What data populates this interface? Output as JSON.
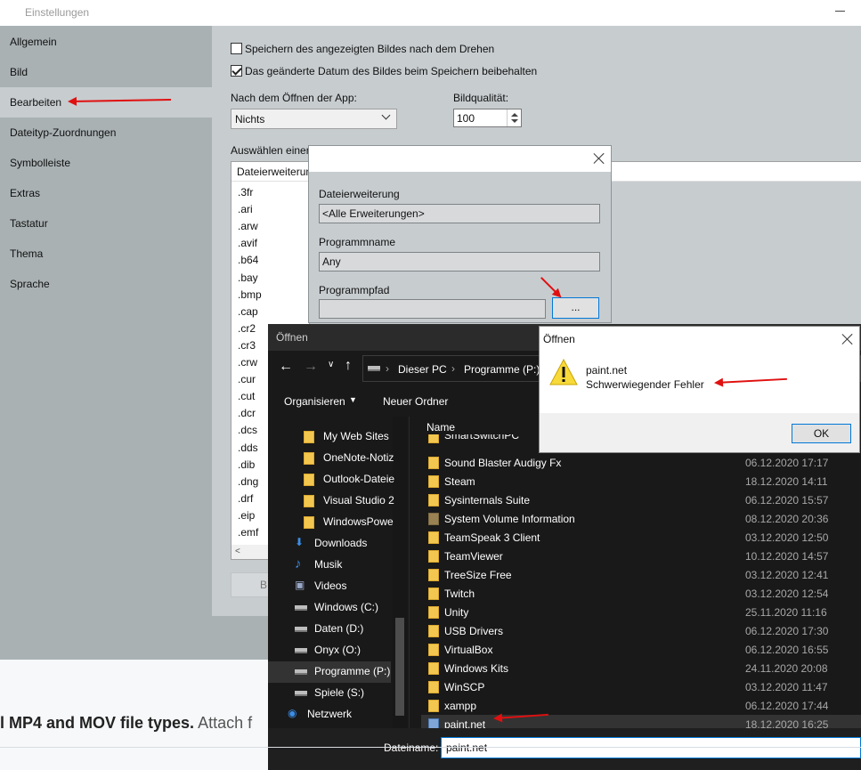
{
  "settings": {
    "title": "Einstellungen",
    "sidebar": [
      {
        "label": "Allgemein"
      },
      {
        "label": "Bild"
      },
      {
        "label": "Bearbeiten",
        "active": true
      },
      {
        "label": "Dateityp-Zuordnungen"
      },
      {
        "label": "Symbolleiste"
      },
      {
        "label": "Extras"
      },
      {
        "label": "Tastatur"
      },
      {
        "label": "Thema"
      },
      {
        "label": "Sprache"
      }
    ],
    "save_rotated_label": "Speichern des angezeigten Bildes nach dem Drehen",
    "save_rotated_checked": false,
    "keep_date_label": "Das geänderte Datum des Bildes beim Speichern beibehalten",
    "keep_date_checked": true,
    "after_open_label": "Nach dem Öffnen der App:",
    "after_open_value": "Nichts",
    "quality_label": "Bildqualität:",
    "quality_value": "100",
    "select_label": "Auswählen einer",
    "ext_header": "Dateierweiterung",
    "extensions": [
      ".3fr",
      ".ari",
      ".arw",
      ".avif",
      ".b64",
      ".bay",
      ".bmp",
      ".cap",
      ".cr2",
      ".cr3",
      ".crw",
      ".cur",
      ".cut",
      ".dcr",
      ".dcs",
      ".dds",
      ".dib",
      ".dng",
      ".drf",
      ".eip",
      ".emf"
    ],
    "ghost_button_label": "B"
  },
  "edit_dialog": {
    "ext_label": "Dateierweiterung",
    "ext_value": "<Alle Erweiterungen>",
    "prog_label": "Programmname",
    "prog_value": "Any",
    "path_label": "Programmpfad",
    "path_value": "",
    "browse_label": "..."
  },
  "open_dialog": {
    "title": "Öffnen",
    "breadcrumb": [
      "Dieser PC",
      "Programme (P:)"
    ],
    "organize_label": "Organisieren",
    "new_folder_label": "Neuer Ordner",
    "nav_items": [
      {
        "label": "My Web Sites",
        "icon": "folder-icon"
      },
      {
        "label": "OneNote-Notiz",
        "icon": "folder-icon"
      },
      {
        "label": "Outlook-Dateie",
        "icon": "folder-icon"
      },
      {
        "label": "Visual Studio 2",
        "icon": "folder-icon"
      },
      {
        "label": "WindowsPowe",
        "icon": "folder-icon"
      },
      {
        "label": "Downloads",
        "icon": "download-icon"
      },
      {
        "label": "Musik",
        "icon": "music-icon"
      },
      {
        "label": "Videos",
        "icon": "video-icon"
      },
      {
        "label": "Windows (C:)",
        "icon": "windows-drive-icon"
      },
      {
        "label": "Daten (D:)",
        "icon": "drive-icon"
      },
      {
        "label": "Onyx (O:)",
        "icon": "drive-icon"
      },
      {
        "label": "Programme (P:)",
        "icon": "drive-icon",
        "selected": true
      },
      {
        "label": "Spiele (S:)",
        "icon": "drive-icon"
      },
      {
        "label": "Netzwerk",
        "icon": "network-icon"
      }
    ],
    "column_name": "Name",
    "files": [
      {
        "name": "SmartSwitchPC",
        "date": "",
        "kind": "folder"
      },
      {
        "name": "Sound Blaster Audigy Fx",
        "date": "06.12.2020 17:17",
        "kind": "folder"
      },
      {
        "name": "Steam",
        "date": "18.12.2020 14:11",
        "kind": "folder"
      },
      {
        "name": "Sysinternals Suite",
        "date": "06.12.2020 15:57",
        "kind": "folder"
      },
      {
        "name": "System Volume Information",
        "date": "08.12.2020 20:36",
        "kind": "system"
      },
      {
        "name": "TeamSpeak 3 Client",
        "date": "03.12.2020 12:50",
        "kind": "folder"
      },
      {
        "name": "TeamViewer",
        "date": "10.12.2020 14:57",
        "kind": "folder"
      },
      {
        "name": "TreeSize Free",
        "date": "03.12.2020 12:41",
        "kind": "folder"
      },
      {
        "name": "Twitch",
        "date": "03.12.2020 12:54",
        "kind": "folder"
      },
      {
        "name": "Unity",
        "date": "25.11.2020 11:16",
        "kind": "folder"
      },
      {
        "name": "USB Drivers",
        "date": "06.12.2020 17:30",
        "kind": "folder"
      },
      {
        "name": "VirtualBox",
        "date": "06.12.2020 16:55",
        "kind": "folder"
      },
      {
        "name": "Windows Kits",
        "date": "24.11.2020 20:08",
        "kind": "folder"
      },
      {
        "name": "WinSCP",
        "date": "03.12.2020 11:47",
        "kind": "folder"
      },
      {
        "name": "xampp",
        "date": "06.12.2020 17:44",
        "kind": "folder"
      },
      {
        "name": "paint.net",
        "date": "18.12.2020 16:25",
        "kind": "shortcut",
        "selected": true
      }
    ],
    "filename_label": "Dateiname:",
    "filename_value": "paint.net"
  },
  "error_box": {
    "title": "Öffnen",
    "line1": "paint.net",
    "line2": "Schwerwiegender Fehler",
    "ok_label": "OK"
  },
  "page_text": {
    "bold": "l MP4 and MOV file types.",
    "rest": " Attach f"
  },
  "colors": {
    "annotation_arrow": "#e01010",
    "accent": "#0078d7"
  }
}
